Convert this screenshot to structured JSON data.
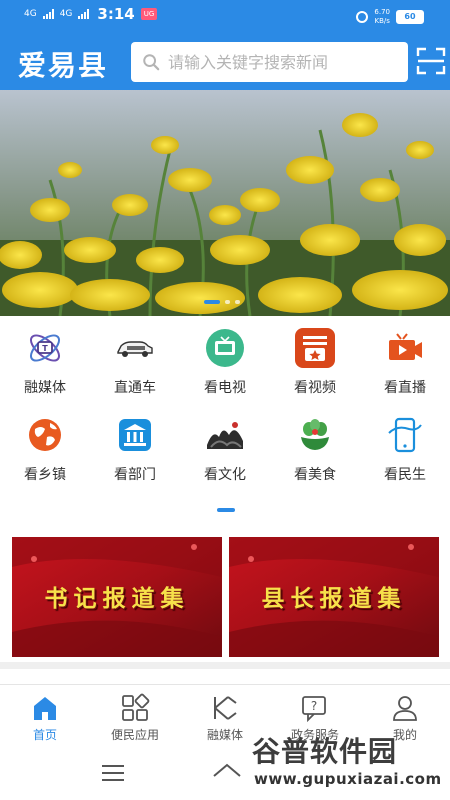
{
  "status_bar": {
    "network1": "4G",
    "network2": "4G",
    "time": "3:14",
    "app_badge": "UG",
    "speed_value": "6.70",
    "speed_unit": "KB/s",
    "battery": "60"
  },
  "header": {
    "app_title": "爱易县",
    "search_placeholder": "请输入关键字搜索新闻"
  },
  "banner": {
    "slide_count": 3,
    "active_slide": 1
  },
  "grid": {
    "items": [
      {
        "label": "融媒体",
        "icon": "media-convergence-icon"
      },
      {
        "label": "直通车",
        "icon": "car-icon"
      },
      {
        "label": "看电视",
        "icon": "tv-icon"
      },
      {
        "label": "看视频",
        "icon": "video-icon"
      },
      {
        "label": "看直播",
        "icon": "live-camera-icon"
      },
      {
        "label": "看乡镇",
        "icon": "globe-icon"
      },
      {
        "label": "看部门",
        "icon": "government-building-icon"
      },
      {
        "label": "看文化",
        "icon": "ink-painting-icon"
      },
      {
        "label": "看美食",
        "icon": "food-plant-icon"
      },
      {
        "label": "看民生",
        "icon": "smartphone-icon"
      }
    ]
  },
  "reports": [
    {
      "label": "书记报道集"
    },
    {
      "label": "县长报道集"
    }
  ],
  "bottom_nav": {
    "items": [
      {
        "label": "首页",
        "icon": "home-icon",
        "active": true
      },
      {
        "label": "便民应用",
        "icon": "apps-icon",
        "active": false
      },
      {
        "label": "融媒体",
        "icon": "media-logo-icon",
        "active": false
      },
      {
        "label": "政务服务",
        "icon": "help-chat-icon",
        "active": false
      },
      {
        "label": "我的",
        "icon": "user-icon",
        "active": false
      }
    ]
  },
  "watermark": {
    "title": "谷普软件园",
    "url": "www.gupuxiazai.com"
  },
  "colors": {
    "primary": "#2b8ae5",
    "report_red": "#b3121b",
    "report_text": "#f7e14a"
  }
}
